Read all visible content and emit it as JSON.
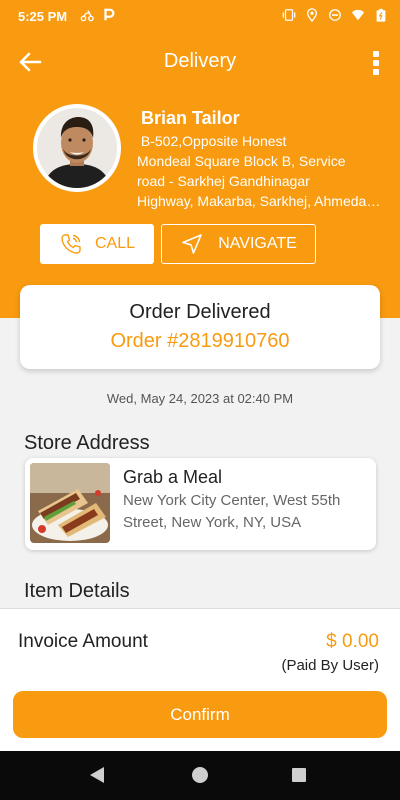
{
  "status_bar": {
    "time": "5:25 PM",
    "icons": [
      "delivery-scooter-icon",
      "parking-p-icon",
      "vibrate-icon",
      "location-icon",
      "do-not-disturb-icon",
      "wifi-icon",
      "battery-icon"
    ]
  },
  "header": {
    "title": "Delivery",
    "back_icon": "arrow-left-icon",
    "menu_icon": "more-vertical-icon"
  },
  "customer": {
    "name": "Brian Tailor",
    "address_line1": " B-502,Opposite Honest",
    "address_line2": "Mondeal Square Block B, Service",
    "address_line3": "road - Sarkhej Gandhinagar",
    "address_line4": "Highway, Makarba, Sarkhej, Ahmedabad"
  },
  "actions": {
    "call_label": "CALL",
    "navigate_label": "NAVIGATE"
  },
  "order": {
    "status": "Order Delivered",
    "number": "Order #2819910760",
    "datetime": "Wed, May 24, 2023 at 02:40 PM"
  },
  "store": {
    "section_title": "Store Address",
    "name": "Grab a Meal",
    "address": "New York City Center, West 55th Street, New York, NY, USA"
  },
  "items": {
    "section_title": "Item Details"
  },
  "invoice": {
    "label": "Invoice Amount",
    "amount": "$ 0.00",
    "note": "(Paid By User)"
  },
  "confirm_label": "Confirm",
  "colors": {
    "accent": "#f99b10",
    "background": "#f2f2f2",
    "card": "#ffffff",
    "nav_bar": "#0a0a0a"
  }
}
